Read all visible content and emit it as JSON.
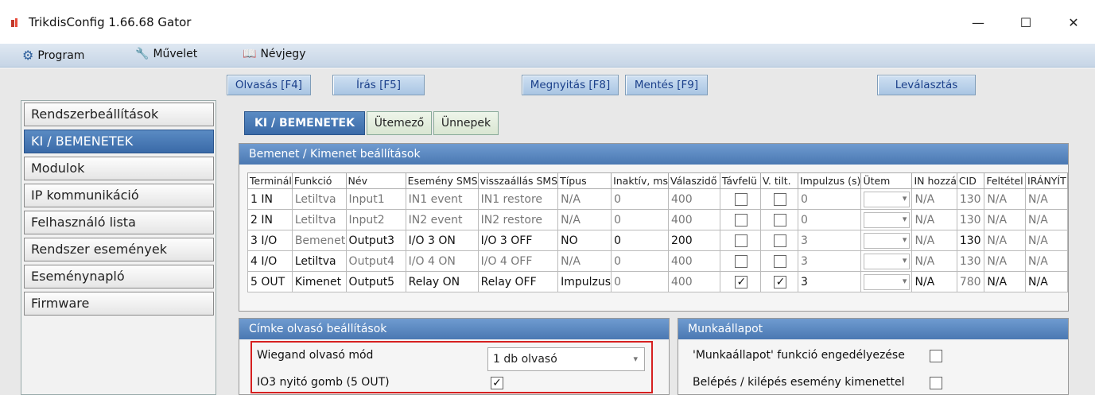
{
  "window": {
    "title": "TrikdisConfig 1.66.68   Gator",
    "minimize": "—",
    "maximize": "☐",
    "close": "✕"
  },
  "menu": {
    "program": "Program",
    "muvelet": "Művelet",
    "nevjegy": "Névjegy"
  },
  "toolbar": {
    "read": "Olvasás [F4]",
    "write": "Írás [F5]",
    "open": "Megnyitás [F8]",
    "save": "Mentés [F9]",
    "disconnect": "Leválasztás"
  },
  "sidebar": {
    "items": [
      {
        "label": "Rendszerbeállítások"
      },
      {
        "label": "KI / BEMENETEK"
      },
      {
        "label": "Modulok"
      },
      {
        "label": "IP kommunikáció"
      },
      {
        "label": "Felhasználó lista"
      },
      {
        "label": "Rendszer események"
      },
      {
        "label": "Eseménynapló"
      },
      {
        "label": "Firmware"
      }
    ]
  },
  "tabs": {
    "io": "KI / BEMENETEK",
    "schedule": "Ütemező",
    "holidays": "Ünnepek"
  },
  "io_panel": {
    "title": "Bemenet / Kimenet beállítások",
    "headers": [
      "Terminál",
      "Funkció",
      "Név",
      "Esemény SMS",
      "visszaállás SMS",
      "Típus",
      "Inaktív, ms",
      "Válaszidő",
      "Távfelü",
      "V. tilt.",
      "Impulzus (s)",
      "Ütem",
      "IN hozzá",
      "CID",
      "Feltétel",
      "IRÁNYÍT"
    ],
    "rows": [
      {
        "terminal": "1 IN",
        "function": "Letiltva",
        "name": "Input1",
        "event": "IN1 event",
        "restore": "IN1 restore",
        "type": "N/A",
        "inactive": "0",
        "response": "400",
        "remote": "",
        "vtilt": "",
        "impulse": "0",
        "in": "N/A",
        "cid": "130",
        "cond": "N/A",
        "dir": "N/A"
      },
      {
        "terminal": "2 IN",
        "function": "Letiltva",
        "name": "Input2",
        "event": "IN2 event",
        "restore": "IN2 restore",
        "type": "N/A",
        "inactive": "0",
        "response": "400",
        "remote": "",
        "vtilt": "",
        "impulse": "0",
        "in": "N/A",
        "cid": "130",
        "cond": "N/A",
        "dir": "N/A"
      },
      {
        "terminal": "3 I/O",
        "function": "Bemenet",
        "name": "Output3",
        "event": "I/O 3 ON",
        "restore": "I/O 3 OFF",
        "type": "NO",
        "inactive": "0",
        "response": "200",
        "remote": "",
        "vtilt": "",
        "impulse": "3",
        "in": "N/A",
        "cid": "130",
        "cond": "N/A",
        "dir": "N/A"
      },
      {
        "terminal": "4 I/O",
        "function": "Letiltva",
        "name": "Output4",
        "event": "I/O 4 ON",
        "restore": "I/O 4 OFF",
        "type": "N/A",
        "inactive": "0",
        "response": "400",
        "remote": "",
        "vtilt": "",
        "impulse": "3",
        "in": "N/A",
        "cid": "130",
        "cond": "N/A",
        "dir": "N/A"
      },
      {
        "terminal": "5 OUT",
        "function": "Kimenet",
        "name": "Output5",
        "event": "Relay ON",
        "restore": "Relay OFF",
        "type": "Impulzus",
        "inactive": "0",
        "response": "400",
        "remote": "✓",
        "vtilt": "✓",
        "impulse": "3",
        "in": "N/A",
        "cid": "780",
        "cond": "N/A",
        "dir": "N/A"
      }
    ]
  },
  "reader_panel": {
    "title": "Címke olvasó beállítások",
    "wiegand_label": "Wiegand olvasó mód",
    "wiegand_value": "1 db olvasó",
    "io3_label": "IO3 nyitó gomb (5 OUT)",
    "io3_checked": "✓"
  },
  "work_panel": {
    "title": "Munkaállapot",
    "enable_label": "'Munkaállapot' funkció engedélyezése",
    "entry_label": "Belépés / kilépés esemény kimenettel"
  },
  "colors": {
    "accent": "#4a78b2",
    "highlight": "#d62020"
  },
  "icons": {
    "app": "app-icon",
    "program": "gear-icon",
    "muvelet": "wrench-icon",
    "nevjegy": "book-icon"
  }
}
